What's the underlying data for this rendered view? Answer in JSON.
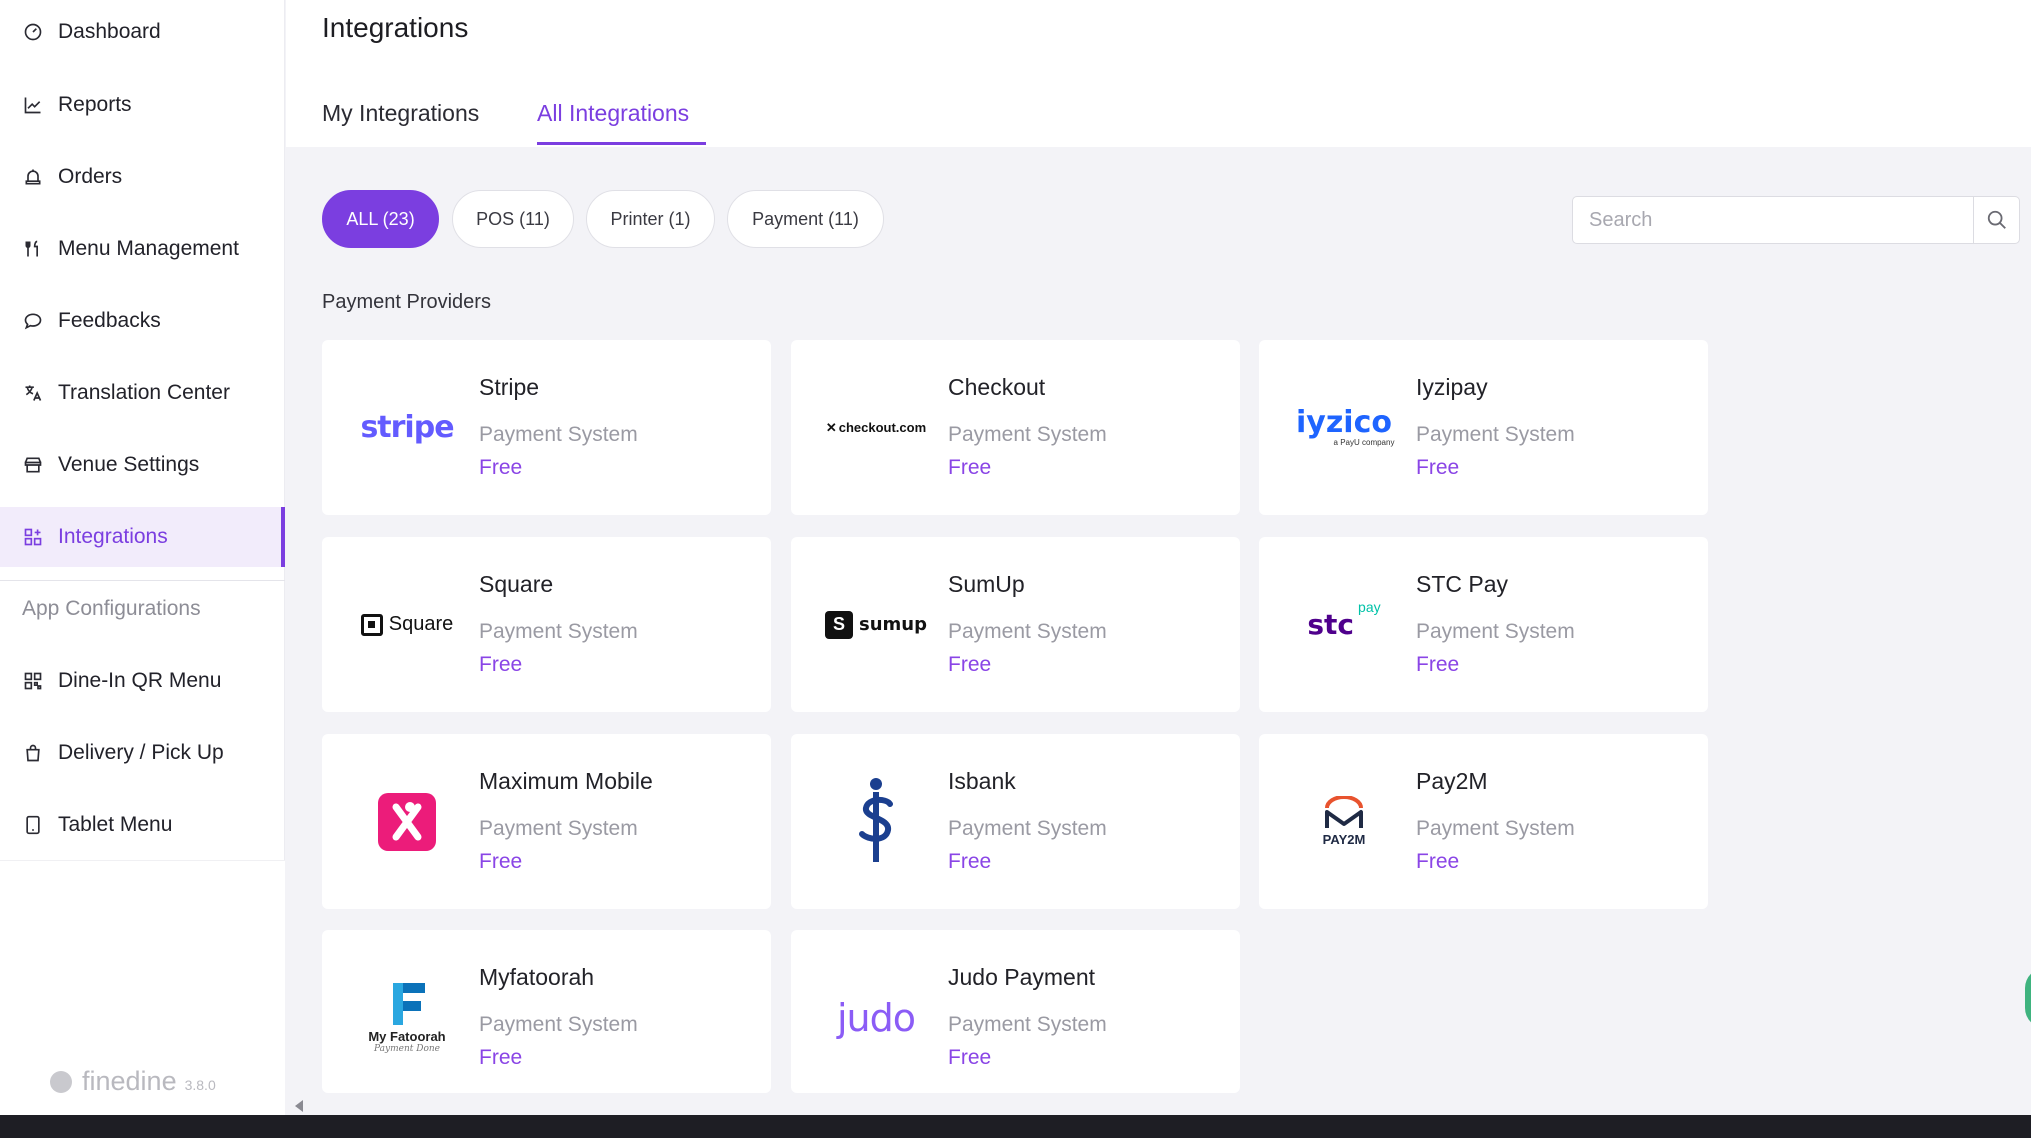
{
  "sidebar": {
    "items": [
      {
        "label": "Dashboard",
        "icon": "gauge-icon"
      },
      {
        "label": "Reports",
        "icon": "chart-line-icon"
      },
      {
        "label": "Orders",
        "icon": "bell-icon"
      },
      {
        "label": "Menu Management",
        "icon": "utensils-icon"
      },
      {
        "label": "Feedbacks",
        "icon": "chat-bubble-icon"
      },
      {
        "label": "Translation Center",
        "icon": "translate-icon"
      },
      {
        "label": "Venue Settings",
        "icon": "storefront-icon"
      },
      {
        "label": "Integrations",
        "icon": "grid-plus-icon",
        "active": true
      }
    ],
    "section_label": "App Configurations",
    "config_items": [
      {
        "label": "Dine-In QR Menu",
        "icon": "qr-code-icon"
      },
      {
        "label": "Delivery / Pick Up",
        "icon": "shopping-bag-icon"
      },
      {
        "label": "Tablet Menu",
        "icon": "tablet-icon"
      }
    ],
    "brand": {
      "name": "finedine",
      "version": "3.8.0"
    }
  },
  "header": {
    "title": "Integrations",
    "tabs": [
      {
        "label": "My Integrations"
      },
      {
        "label": "All Integrations",
        "active": true
      }
    ]
  },
  "filters": {
    "chips": [
      {
        "label": "ALL (23)",
        "active": true
      },
      {
        "label": "POS (11)"
      },
      {
        "label": "Printer (1)"
      },
      {
        "label": "Payment (11)"
      }
    ],
    "search_placeholder": "Search"
  },
  "group": {
    "label": "Payment Providers",
    "cards": [
      {
        "title": "Stripe",
        "subtitle": "Payment System",
        "price": "Free",
        "logo_text": "stripe",
        "logo_color": "#635bff"
      },
      {
        "title": "Checkout",
        "subtitle": "Payment System",
        "price": "Free",
        "logo_text": "checkout.com",
        "logo_color": "#111111"
      },
      {
        "title": "Iyzipay",
        "subtitle": "Payment System",
        "price": "Free",
        "logo_text": "iyzico",
        "logo_sub": "a PayU company",
        "logo_color": "#1e64ff"
      },
      {
        "title": "Square",
        "subtitle": "Payment System",
        "price": "Free",
        "logo_text": "Square",
        "logo_color": "#111111"
      },
      {
        "title": "SumUp",
        "subtitle": "Payment System",
        "price": "Free",
        "logo_text": "sumup",
        "logo_color": "#111111"
      },
      {
        "title": "STC Pay",
        "subtitle": "Payment System",
        "price": "Free",
        "logo_text": "stc",
        "logo_sub": "pay",
        "logo_color": "#4f008c"
      },
      {
        "title": "Maximum Mobile",
        "subtitle": "Payment System",
        "price": "Free",
        "logo_color": "#ec1c7a"
      },
      {
        "title": "Isbank",
        "subtitle": "Payment System",
        "price": "Free",
        "logo_color": "#1b3f8f"
      },
      {
        "title": "Pay2M",
        "subtitle": "Payment System",
        "price": "Free",
        "logo_text": "PAY2M",
        "logo_color": "#1f2a44"
      },
      {
        "title": "Myfatoorah",
        "subtitle": "Payment System",
        "price": "Free",
        "logo_text": "My Fatoorah",
        "logo_sub": "Payment Done",
        "logo_color": "#0b72b9"
      },
      {
        "title": "Judo Payment",
        "subtitle": "Payment System",
        "price": "Free",
        "logo_text": "judo",
        "logo_color": "#8b5cf6"
      }
    ]
  },
  "colors": {
    "accent": "#7b3ee0",
    "price": "#8a45e6",
    "muted": "#9a9aa3"
  }
}
